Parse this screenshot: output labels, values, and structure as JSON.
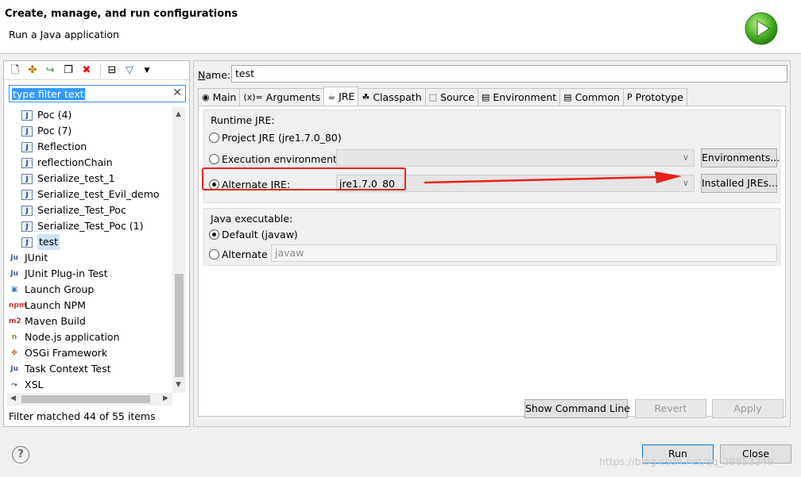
{
  "banner": {
    "title": "Create, manage, and run configurations",
    "subtitle": "Run a Java application",
    "logo_icon": "run-play-icon"
  },
  "left": {
    "toolbar_icons": [
      "new-config-icon",
      "new-prototype-icon",
      "export-icon",
      "duplicate-icon",
      "delete-icon",
      "collapse-all-icon",
      "filter-icon",
      "view-menu-icon"
    ],
    "filter_text": "type filter text",
    "tree": [
      {
        "label": "Poc (4)",
        "icon": "java-app-icon",
        "indent": 1
      },
      {
        "label": "Poc (7)",
        "icon": "java-app-icon",
        "indent": 1
      },
      {
        "label": "Reflection",
        "icon": "java-app-icon",
        "indent": 1
      },
      {
        "label": "reflectionChain",
        "icon": "java-app-icon",
        "indent": 1
      },
      {
        "label": "Serialize_test_1",
        "icon": "java-app-icon",
        "indent": 1
      },
      {
        "label": "Serialize_test_Evil_demo",
        "icon": "java-app-icon",
        "indent": 1
      },
      {
        "label": "Serialize_Test_Poc",
        "icon": "java-app-icon",
        "indent": 1
      },
      {
        "label": "Serialize_Test_Poc (1)",
        "icon": "java-app-icon",
        "indent": 1
      },
      {
        "label": "test",
        "icon": "java-app-icon",
        "indent": 1,
        "selected": true
      },
      {
        "label": "JUnit",
        "icon": "junit-icon",
        "indent": 0
      },
      {
        "label": "JUnit Plug-in Test",
        "icon": "junit-plugin-icon",
        "indent": 0
      },
      {
        "label": "Launch Group",
        "icon": "launch-group-icon",
        "indent": 0
      },
      {
        "label": "Launch NPM",
        "icon": "npm-icon",
        "indent": 0
      },
      {
        "label": "Maven Build",
        "icon": "maven-icon",
        "indent": 0
      },
      {
        "label": "Node.js application",
        "icon": "nodejs-icon",
        "indent": 0
      },
      {
        "label": "OSGi Framework",
        "icon": "osgi-icon",
        "indent": 0
      },
      {
        "label": "Task Context Test",
        "icon": "task-context-icon",
        "indent": 0
      },
      {
        "label": "XSL",
        "icon": "xsl-icon",
        "indent": 0
      }
    ],
    "status": "Filter matched 44 of 55 items"
  },
  "right": {
    "name_label": "Name:",
    "name_value": "test",
    "tabs": [
      {
        "label": "Main",
        "icon": "main-tab-icon"
      },
      {
        "label": "Arguments",
        "icon": "arguments-tab-icon"
      },
      {
        "label": "JRE",
        "icon": "jre-tab-icon",
        "active": true
      },
      {
        "label": "Classpath",
        "icon": "classpath-tab-icon"
      },
      {
        "label": "Source",
        "icon": "source-tab-icon"
      },
      {
        "label": "Environment",
        "icon": "environment-tab-icon"
      },
      {
        "label": "Common",
        "icon": "common-tab-icon"
      },
      {
        "label": "Prototype",
        "icon": "prototype-tab-icon"
      }
    ],
    "runtime_group": {
      "title": "Runtime JRE:",
      "project_jre": "Project JRE (jre1.7.0_80)",
      "execution_env": "Execution environment:",
      "environments_btn": "Environments...",
      "alternate_jre": "Alternate JRE:",
      "alternate_value": "jre1.7.0_80",
      "installed_btn": "Installed JREs...",
      "selected": "alternate"
    },
    "executable_group": {
      "title": "Java executable:",
      "default": "Default (javaw)",
      "alternate": "Alternate",
      "alternate_value": "javaw",
      "selected": "default"
    },
    "show_command_line": "Show Command Line",
    "revert": "Revert",
    "apply": "Apply"
  },
  "footer": {
    "run": "Run",
    "close": "Close",
    "watermark": "https://blog.csdn.net/qq_39853249"
  },
  "colors": {
    "highlight": "#e8231b",
    "selection": "#3399ff"
  }
}
